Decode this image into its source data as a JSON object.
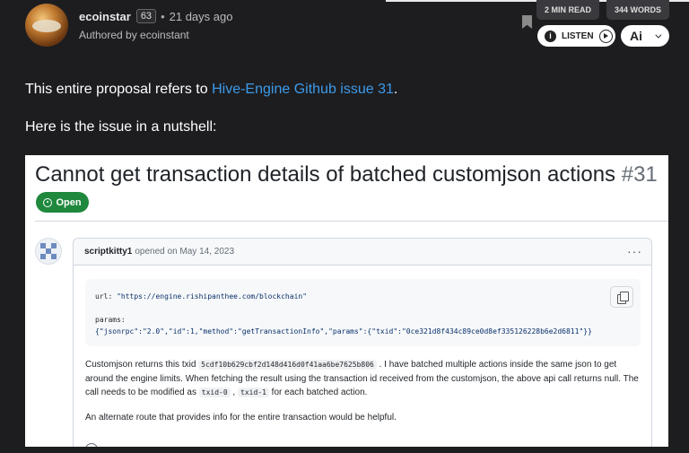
{
  "header": {
    "author": "ecoinstar",
    "reputation": "63",
    "separator": "•",
    "time_ago": "21 days ago",
    "authored_by": "Authored by ecoinstant",
    "read_time": "2 MIN READ",
    "word_count": "344 WORDS",
    "listen_label": "LISTEN",
    "ai_label": "Ai"
  },
  "post": {
    "p1_prefix": "This entire proposal refers to ",
    "p1_link": "Hive-Engine Github issue 31",
    "p1_suffix": ".",
    "p2": "Here is the issue in a nutshell:"
  },
  "issue": {
    "title": "Cannot get transaction details of batched customjson actions",
    "number": "#31",
    "status": "Open",
    "comment": {
      "author": "scriptkitty1",
      "meta": "opened on May 14, 2023",
      "code_url_key": "url: ",
      "code_url_val": "\"https://engine.rishipanthee.com/blockchain\"",
      "code_params_key": "params:",
      "code_params_val": "{\"jsonrpc\":\"2.0\",\"id\":1,\"method\":\"getTransactionInfo\",\"params\":{\"txid\":\"0ce321d8f434c89ce0d8ef335126228b6e2d6811\"}}",
      "desc_1": "Customjson returns this txid ",
      "txid": "5cdf10b629cbf2d148d416d0f41aa6be7625b806",
      "desc_2": " . I have batched multiple actions inside the same json to get around the engine limits. When fetching the result using the transaction id received from the customjson, the above api call returns null. The call needs to be modified as ",
      "code_txid0": "txid-0",
      "desc_3": " , ",
      "code_txid1": "txid-1",
      "desc_4": " for each batched action.",
      "desc_alt": "An alternate route that provides info for the entire transaction would be helpful."
    }
  },
  "colors": {
    "background": "#1d1d20",
    "link": "#3d9ae8",
    "open_badge": "#1f883d"
  }
}
